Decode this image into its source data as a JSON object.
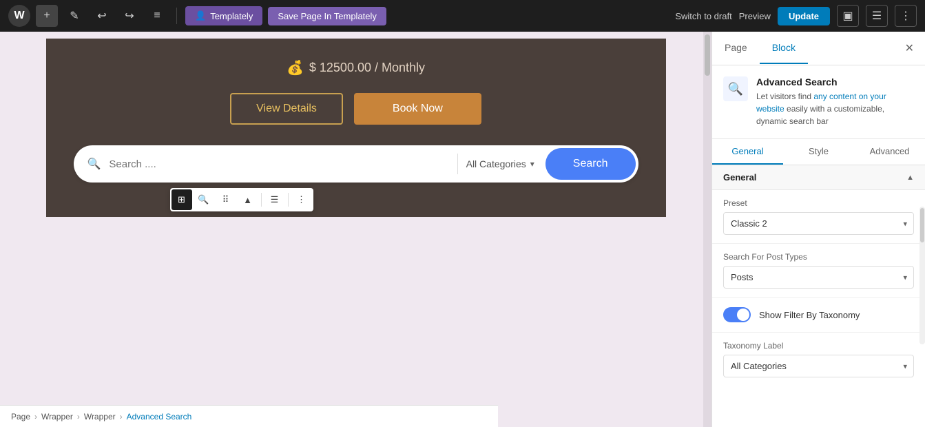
{
  "topbar": {
    "wp_logo": "W",
    "add_label": "+",
    "edit_label": "✎",
    "undo_label": "↩",
    "redo_label": "↪",
    "list_label": "≡",
    "templately_label": "Templately",
    "save_page_label": "Save Page In Templately",
    "switch_draft_label": "Switch to draft",
    "preview_label": "Preview",
    "update_label": "Update"
  },
  "canvas": {
    "price_icon": "💰",
    "price_text": "$ 12500.00 / Monthly",
    "view_details_label": "View Details",
    "book_now_label": "Book Now",
    "search_placeholder": "Search ....",
    "category_label": "All Categories",
    "search_button_label": "Search"
  },
  "panel": {
    "page_tab": "Page",
    "block_tab": "Block",
    "block_icon": "🔍",
    "block_title": "Advanced Search",
    "block_desc_part1": "Let visitors find ",
    "block_desc_highlight": "any content on your website",
    "block_desc_part2": " easily with a customizable, dynamic search bar",
    "tabs": {
      "general": "General",
      "style": "Style",
      "advanced": "Advanced"
    },
    "general_section": "General",
    "preset_label": "Preset",
    "preset_value": "Classic 2",
    "search_for_label": "Search For Post Types",
    "search_for_value": "Posts",
    "toggle_label": "Show Filter By Taxonomy",
    "taxonomy_label_title": "Taxonomy Label",
    "taxonomy_label_value": "All Categories"
  },
  "breadcrumb": {
    "items": [
      "Page",
      "Wrapper",
      "Wrapper",
      "Advanced Search"
    ]
  }
}
